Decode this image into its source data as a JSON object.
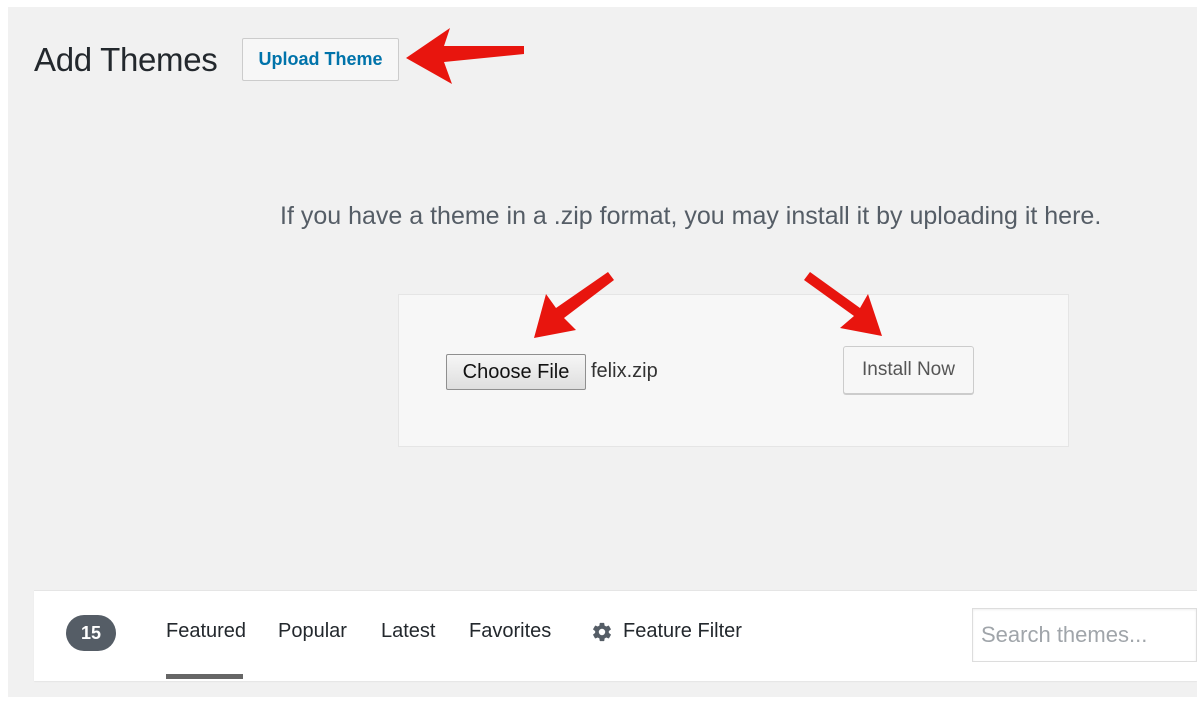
{
  "header": {
    "title": "Add Themes",
    "upload_button_label": "Upload Theme"
  },
  "upload": {
    "help_text": "If you have a theme in a .zip format, you may install it by uploading it here.",
    "choose_file_label": "Choose File",
    "file_name": "felix.zip",
    "install_button_label": "Install Now"
  },
  "filter_bar": {
    "theme_count": "15",
    "tabs": [
      {
        "label": "Featured",
        "current": true
      },
      {
        "label": "Popular",
        "current": false
      },
      {
        "label": "Latest",
        "current": false
      },
      {
        "label": "Favorites",
        "current": false
      }
    ],
    "feature_filter_label": "Feature Filter",
    "feature_filter_icon": "gear-icon",
    "search_placeholder": "Search themes..."
  },
  "annotations": {
    "arrow_color": "#e8150e"
  }
}
